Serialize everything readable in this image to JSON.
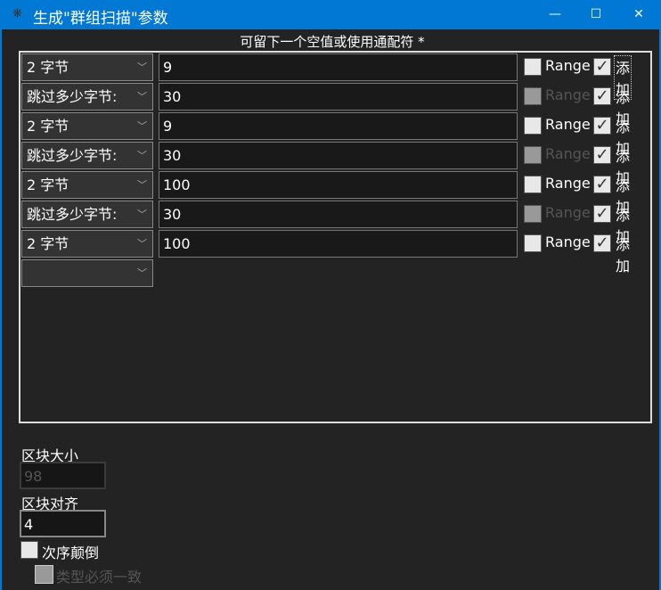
{
  "window": {
    "title": "生成\"群组扫描\"参数",
    "minimize": "—",
    "maximize": "☐",
    "close": "✕"
  },
  "hint": "可留下一个空值或使用通配符 *",
  "rows": [
    {
      "type": "2 字节",
      "value": "9",
      "range_label": "Range",
      "range_enabled": true,
      "add_label": "添加",
      "add_checked": true
    },
    {
      "type": "跳过多少字节:",
      "value": "30",
      "range_label": "Range",
      "range_enabled": false,
      "add_label": "添加",
      "add_checked": true
    },
    {
      "type": "2 字节",
      "value": "9",
      "range_label": "Range",
      "range_enabled": true,
      "add_label": "添加",
      "add_checked": true
    },
    {
      "type": "跳过多少字节:",
      "value": "30",
      "range_label": "Range",
      "range_enabled": false,
      "add_label": "添加",
      "add_checked": true
    },
    {
      "type": "2 字节",
      "value": "100",
      "range_label": "Range",
      "range_enabled": true,
      "add_label": "添加",
      "add_checked": true
    },
    {
      "type": "跳过多少字节:",
      "value": "30",
      "range_label": "Range",
      "range_enabled": false,
      "add_label": "添加",
      "add_checked": true
    },
    {
      "type": "2 字节",
      "value": "100",
      "range_label": "Range",
      "range_enabled": true,
      "add_label": "添加",
      "add_checked": true
    }
  ],
  "block_size": {
    "label": "区块大小",
    "value": "98"
  },
  "block_align": {
    "label": "区块对齐",
    "value": "4"
  },
  "reverse_order": {
    "label": "次序颠倒"
  },
  "type_must_match": {
    "label": "类型必须一致"
  }
}
